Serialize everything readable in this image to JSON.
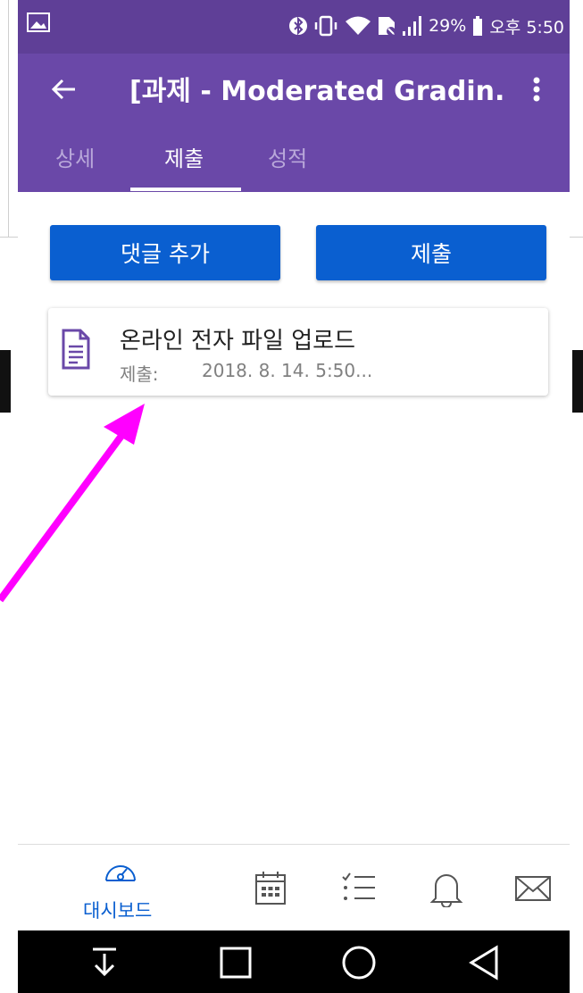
{
  "status_bar": {
    "battery": "29%",
    "time": "오후 5:50",
    "icons": [
      "image-icon",
      "bluetooth-icon",
      "vibrate-icon",
      "wifi-icon",
      "no-sim-icon",
      "signal-icon",
      "battery-icon"
    ]
  },
  "app_bar": {
    "back_icon": "arrow-left-icon",
    "title": "[과제 - Moderated Gradin...",
    "more_icon": "more-vertical-icon"
  },
  "tabs": [
    {
      "label": "상세",
      "active": false
    },
    {
      "label": "제출",
      "active": true
    },
    {
      "label": "성적",
      "active": false
    }
  ],
  "actions": {
    "add_comment": "댓글 추가",
    "submit": "제출"
  },
  "submission_card": {
    "icon": "document-icon",
    "title": "온라인 전자 파일 업로드",
    "submitted_label": "제출:",
    "submitted_value": "2018. 8. 14. 5:50..."
  },
  "bottom_nav": {
    "dashboard_label": "대시보드",
    "items": [
      "dashboard-icon",
      "calendar-icon",
      "todo-list-icon",
      "bell-icon",
      "mail-icon"
    ]
  },
  "system_nav": [
    "download-icon",
    "square-icon",
    "circle-icon",
    "triangle-back-icon"
  ],
  "colors": {
    "status_bar": "#5f3f97",
    "app_bar": "#6a48a8",
    "primary_button": "#0a5fd0",
    "annotation_arrow": "#ff00ff"
  }
}
